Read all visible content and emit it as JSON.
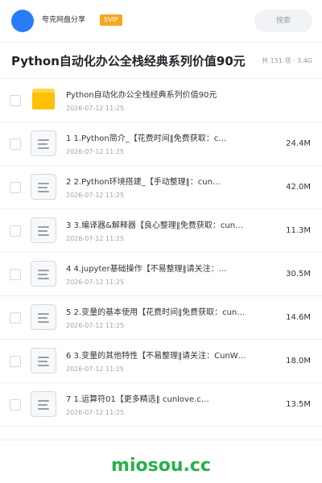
{
  "header": {
    "user_name": "夸克网盘分享",
    "badge": "SVIP",
    "search_placeholder": "搜索"
  },
  "share": {
    "title": "Python自动化办公全栈经典系列价值90元",
    "meta": "共 151 项 · 3.4G"
  },
  "files": [
    {
      "icon": "folder-icon",
      "name": "Python自动化办公全栈经典系列价值90元",
      "date": "2026-07-12 11:25",
      "size": ""
    },
    {
      "icon": "document-icon",
      "name": "1 1.Python简介_【花费时间‖免费获取：c…",
      "date": "2026-07-12 11:25",
      "size": "24.4M"
    },
    {
      "icon": "document-icon",
      "name": "2 2.Python环境搭建_【手动整理‖：cun…",
      "date": "2026-07-12 11:25",
      "size": "42.0M"
    },
    {
      "icon": "document-icon",
      "name": "3 3.编译器&解释器【良心整理‖免费获取：cun…",
      "date": "2026-07-12 11:25",
      "size": "11.3M"
    },
    {
      "icon": "document-icon",
      "name": "4 4.jupyter基础操作【不易整理‖请关注：…",
      "date": "2026-07-12 11:25",
      "size": "30.5M"
    },
    {
      "icon": "document-icon",
      "name": "5 2.变量的基本使用【花费时间‖免费获取：cun…",
      "date": "2026-07-12 11:25",
      "size": "14.6M"
    },
    {
      "icon": "document-icon",
      "name": "6 3.变量的其他特性【不易整理‖请关注：CunW…",
      "date": "2026-07-12 11:25",
      "size": "18.0M"
    },
    {
      "icon": "document-icon",
      "name": "7 1.运算符01【更多精选‖ cunlove.c…",
      "date": "2026-07-12 11:25",
      "size": "13.5M"
    }
  ],
  "footer": {
    "watermark": "miosou.cc"
  },
  "colors": {
    "accent": "#2a7cf6",
    "svip": "#f5a623",
    "folder": "#ffc107",
    "watermark": "#27b04a"
  }
}
